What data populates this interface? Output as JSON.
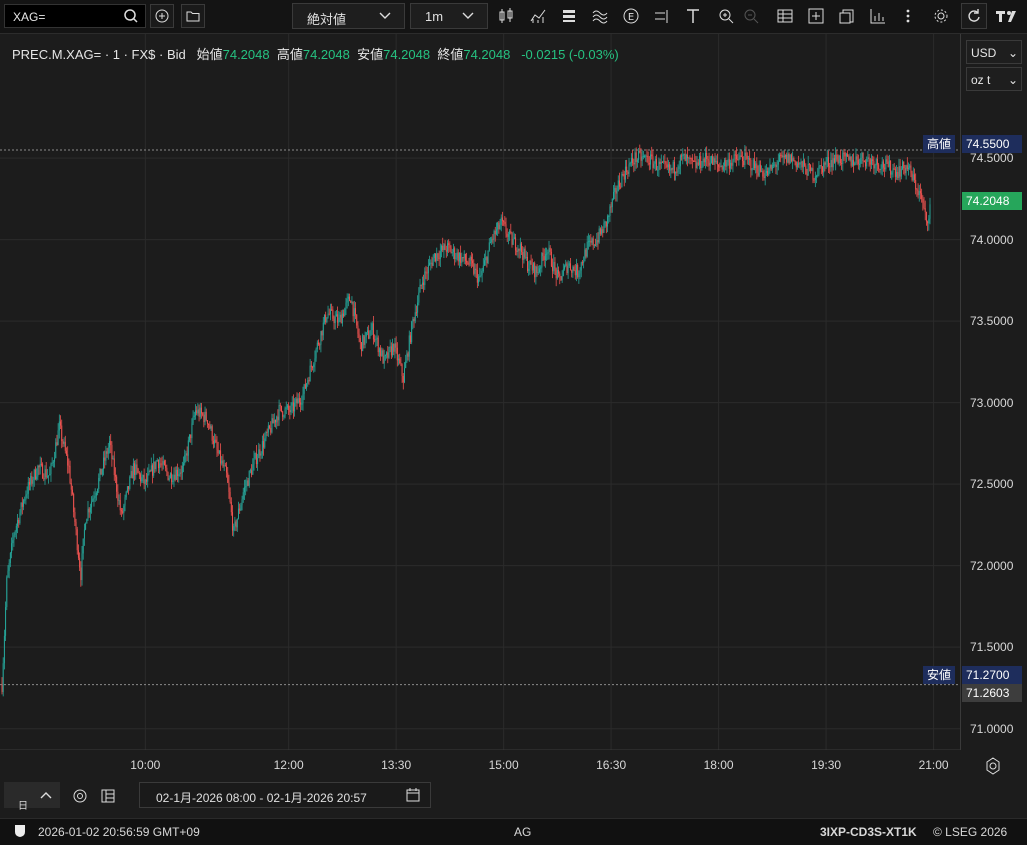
{
  "toolbar": {
    "symbol": "XAG=",
    "scale_mode": "絶対値",
    "interval": "1m"
  },
  "legend": {
    "instrument": "PREC.M.XAG= · 1 · FX$ · Bid",
    "open_label": "始値",
    "open_value": "74.2048",
    "high_label": "高値",
    "high_value": "74.2048",
    "low_label": "安値",
    "low_value": "74.2048",
    "close_label": "終値",
    "close_value": "74.2048",
    "change": "-0.0215 (-0.03%)"
  },
  "units": {
    "currency": "USD",
    "weight": "oz t"
  },
  "price_tags": {
    "high_label": "高値",
    "high_value": "74.5500",
    "last_value": "74.2048",
    "low_label": "安値",
    "low_value": "71.2700",
    "cursor_value": "71.2603"
  },
  "bottom": {
    "day_label": "日",
    "date_range": "02-1月-2026 08:00  -  02-1月-2026 20:57"
  },
  "status": {
    "timestamp": "2026-01-02 20:56:59 GMT+09",
    "center": "AG",
    "code": "3IXP-CD3S-XT1K",
    "copyright": "© LSEG 2026"
  },
  "colors": {
    "up": "#26a69a",
    "down": "#ef5350",
    "accent_up": "#26c281",
    "tag_blue": "#1e2d5c"
  },
  "chart_data": {
    "type": "candlestick",
    "x_tick_labels": [
      "10:00",
      "12:00",
      "13:30",
      "15:00",
      "16:30",
      "18:00",
      "19:30",
      "21:00"
    ],
    "x_tick_minutes": [
      600,
      720,
      810,
      900,
      990,
      1080,
      1170,
      1260
    ],
    "x_range_minutes": [
      480,
      1257
    ],
    "ylim": [
      70.9,
      75.2
    ],
    "y_ticks": [
      "71.0000",
      "71.5000",
      "72.0000",
      "72.5000",
      "73.0000",
      "73.5000",
      "74.0000",
      "74.5000"
    ],
    "y_tick_values": [
      71.0,
      71.5,
      72.0,
      72.5,
      73.0,
      73.5,
      74.0,
      74.5
    ],
    "high": 74.55,
    "low": 71.27,
    "last": 74.2048,
    "path_points": [
      [
        480,
        71.27
      ],
      [
        484,
        71.9
      ],
      [
        490,
        72.2
      ],
      [
        500,
        72.45
      ],
      [
        510,
        72.6
      ],
      [
        520,
        72.55
      ],
      [
        528,
        72.85
      ],
      [
        536,
        72.6
      ],
      [
        542,
        72.2
      ],
      [
        546,
        71.95
      ],
      [
        550,
        72.3
      ],
      [
        560,
        72.5
      ],
      [
        570,
        72.75
      ],
      [
        580,
        72.3
      ],
      [
        590,
        72.6
      ],
      [
        600,
        72.5
      ],
      [
        610,
        72.65
      ],
      [
        620,
        72.55
      ],
      [
        632,
        72.6
      ],
      [
        642,
        72.95
      ],
      [
        652,
        72.9
      ],
      [
        660,
        72.7
      ],
      [
        668,
        72.55
      ],
      [
        674,
        72.2
      ],
      [
        682,
        72.45
      ],
      [
        692,
        72.65
      ],
      [
        702,
        72.8
      ],
      [
        712,
        72.95
      ],
      [
        722,
        72.95
      ],
      [
        732,
        73.05
      ],
      [
        742,
        73.3
      ],
      [
        752,
        73.55
      ],
      [
        762,
        73.5
      ],
      [
        772,
        73.65
      ],
      [
        780,
        73.35
      ],
      [
        790,
        73.45
      ],
      [
        800,
        73.25
      ],
      [
        808,
        73.35
      ],
      [
        816,
        73.15
      ],
      [
        824,
        73.5
      ],
      [
        832,
        73.75
      ],
      [
        842,
        73.9
      ],
      [
        852,
        73.95
      ],
      [
        862,
        73.9
      ],
      [
        872,
        73.85
      ],
      [
        880,
        73.75
      ],
      [
        890,
        74.0
      ],
      [
        898,
        74.1
      ],
      [
        906,
        74.0
      ],
      [
        914,
        73.95
      ],
      [
        920,
        73.85
      ],
      [
        928,
        73.8
      ],
      [
        936,
        73.95
      ],
      [
        946,
        73.75
      ],
      [
        954,
        73.85
      ],
      [
        962,
        73.8
      ],
      [
        970,
        73.95
      ],
      [
        978,
        74.0
      ],
      [
        986,
        74.1
      ],
      [
        994,
        74.3
      ],
      [
        1000,
        74.4
      ],
      [
        1010,
        74.5
      ],
      [
        1020,
        74.5
      ],
      [
        1030,
        74.45
      ],
      [
        1040,
        74.42
      ],
      [
        1050,
        74.5
      ],
      [
        1060,
        74.45
      ],
      [
        1070,
        74.5
      ],
      [
        1080,
        74.45
      ],
      [
        1090,
        74.48
      ],
      [
        1100,
        74.5
      ],
      [
        1110,
        74.45
      ],
      [
        1120,
        74.4
      ],
      [
        1130,
        74.48
      ],
      [
        1140,
        74.5
      ],
      [
        1150,
        74.45
      ],
      [
        1160,
        74.4
      ],
      [
        1170,
        74.47
      ],
      [
        1180,
        74.5
      ],
      [
        1190,
        74.48
      ],
      [
        1200,
        74.5
      ],
      [
        1210,
        74.48
      ],
      [
        1220,
        74.45
      ],
      [
        1230,
        74.42
      ],
      [
        1238,
        74.45
      ],
      [
        1244,
        74.35
      ],
      [
        1250,
        74.25
      ],
      [
        1254,
        74.1
      ],
      [
        1257,
        74.2048
      ]
    ]
  }
}
